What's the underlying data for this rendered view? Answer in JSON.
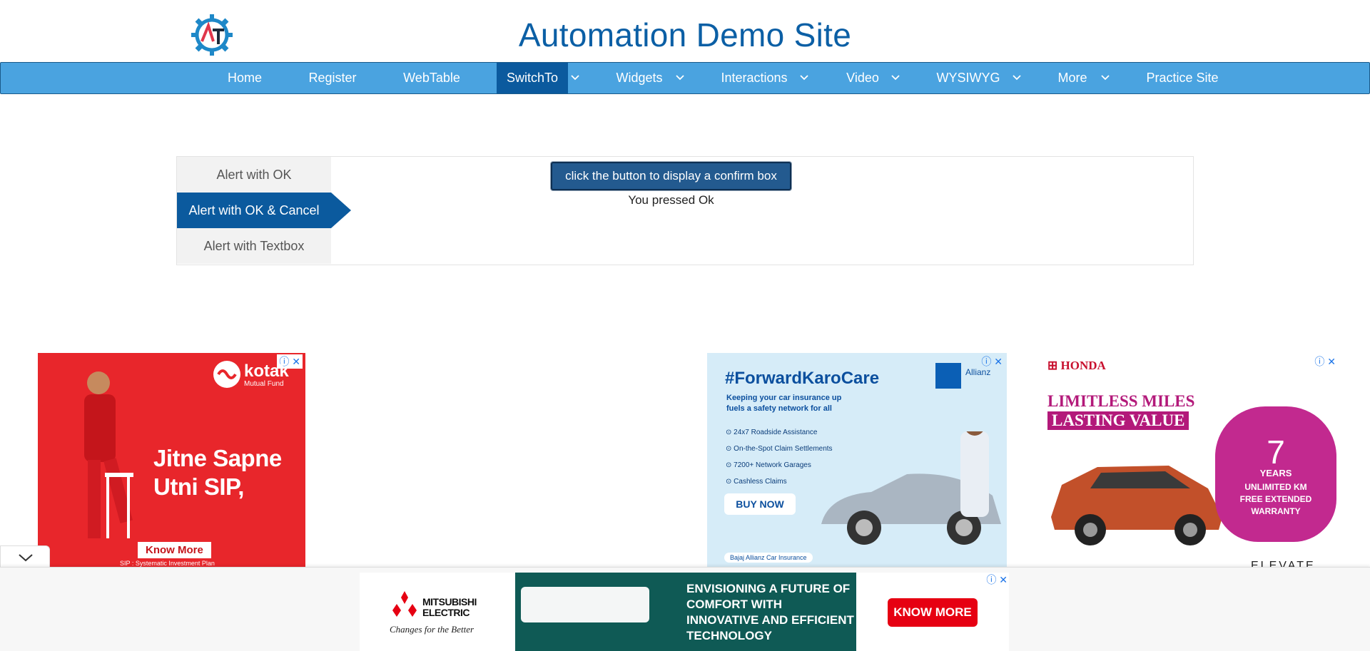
{
  "site": {
    "title": "Automation Demo Site",
    "logo_letters": "AT"
  },
  "nav": {
    "items": [
      {
        "label": "Home",
        "dropdown": false
      },
      {
        "label": "Register",
        "dropdown": false
      },
      {
        "label": "WebTable",
        "dropdown": false
      },
      {
        "label": "SwitchTo",
        "dropdown": true,
        "active": true
      },
      {
        "label": "Widgets",
        "dropdown": true
      },
      {
        "label": "Interactions",
        "dropdown": true
      },
      {
        "label": "Video",
        "dropdown": true
      },
      {
        "label": "WYSIWYG",
        "dropdown": true
      },
      {
        "label": "More",
        "dropdown": true
      },
      {
        "label": "Practice Site",
        "dropdown": false
      }
    ]
  },
  "alerts": {
    "tabs": [
      {
        "label": "Alert with OK"
      },
      {
        "label": "Alert with OK & Cancel",
        "active": true
      },
      {
        "label": "Alert with Textbox"
      }
    ],
    "button_label": "click the button to display a confirm box",
    "result": "You pressed Ok"
  },
  "ads": {
    "kotak": {
      "brand": "kotak",
      "sub": "Mutual Fund",
      "headline": "Jitne Sapne Utni SIP,",
      "cta": "Know More",
      "footnote": "SIP : Systematic Investment Plan"
    },
    "bajaj": {
      "headline": "#ForwardKaroCare",
      "sub": "Keeping your car insurance up fuels a safety network for all",
      "features": [
        "24x7 Roadside Assistance",
        "On-the-Spot Claim Settlements",
        "7200+ Network Garages",
        "Cashless Claims"
      ],
      "cta": "BUY NOW",
      "brand": "Allianz",
      "footer": "Bajaj Allianz Car Insurance"
    },
    "honda": {
      "brand": "HONDA",
      "line1": "LIMITLESS MILES",
      "line2": "LASTING VALUE",
      "badge_big": "7",
      "badge_years": "YEARS",
      "badge_text": "UNLIMITED KM FREE EXTENDED WARRANTY",
      "model": "ELEVATE"
    },
    "mitsubishi": {
      "brand": "MITSUBISHI ELECTRIC",
      "tagline": "Changes for the Better",
      "headline": "ENVISIONING A FUTURE OF COMFORT WITH INNOVATIVE AND EFFICIENT TECHNOLOGY",
      "cta": "KNOW MORE"
    }
  },
  "colors": {
    "nav": "#4aa3e0",
    "active": "#0b5a9e",
    "title": "#0b5fa5"
  }
}
